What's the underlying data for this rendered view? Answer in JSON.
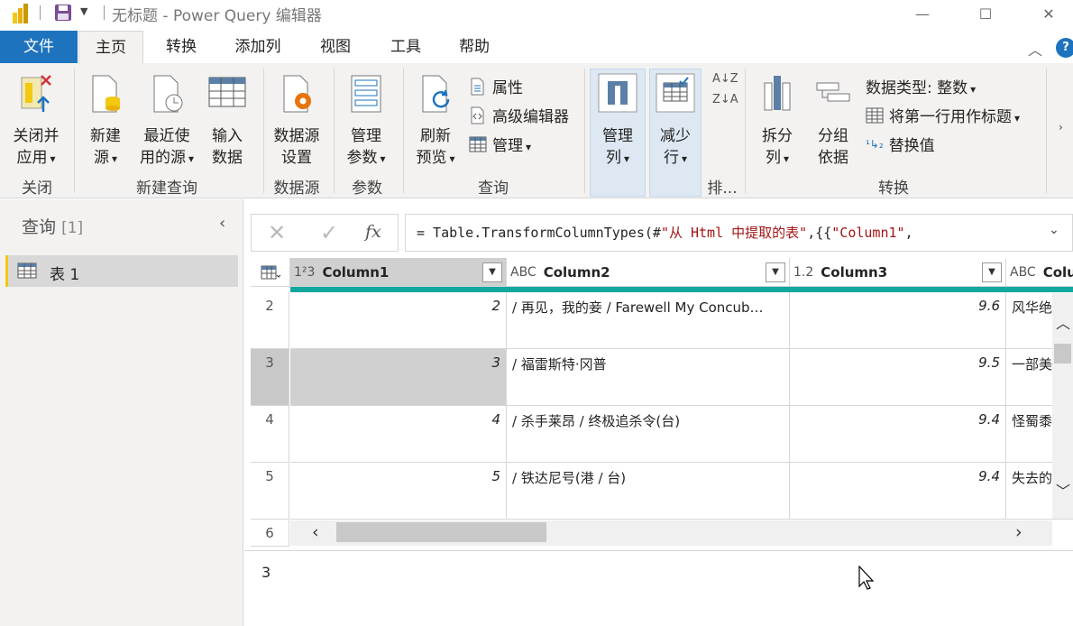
{
  "window": {
    "title": "无标题 - Power Query 编辑器",
    "minimize": "—",
    "maximize": "☐",
    "close": "✕"
  },
  "tabs": [
    {
      "label": "文件"
    },
    {
      "label": "主页"
    },
    {
      "label": "转换"
    },
    {
      "label": "添加列"
    },
    {
      "label": "视图"
    },
    {
      "label": "工具"
    },
    {
      "label": "帮助"
    }
  ],
  "help": "?",
  "ribbon": {
    "close_apply": {
      "line1": "关闭并",
      "line2": "应用"
    },
    "new_source": {
      "line1": "新建",
      "line2": "源"
    },
    "recent_sources": {
      "line1": "最近使",
      "line2": "用的源"
    },
    "enter_data": {
      "line1": "输入",
      "line2": "数据"
    },
    "ds_settings": {
      "line1": "数据源",
      "line2": "设置"
    },
    "manage_params": {
      "line1": "管理",
      "line2": "参数"
    },
    "refresh": {
      "line1": "刷新",
      "line2": "预览"
    },
    "properties": "属性",
    "advanced_editor": "高级编辑器",
    "manage": "管理",
    "manage_columns": {
      "line1": "管理",
      "line2": "列"
    },
    "reduce_rows": {
      "line1": "减少",
      "line2": "行"
    },
    "split_column": {
      "line1": "拆分",
      "line2": "列"
    },
    "group_by": {
      "line1": "分组",
      "line2": "依据"
    },
    "data_type": "数据类型: 整数",
    "first_row_header": "将第一行用作标题",
    "replace_values": "替换值",
    "groups": {
      "close": "关闭",
      "new_query": "新建查询",
      "data_source": "数据源",
      "parameters": "参数",
      "query": "查询",
      "sort": "排...",
      "transform": "转换"
    }
  },
  "queries": {
    "title": "查询",
    "count": "[1]",
    "items": [
      {
        "label": "表 1"
      }
    ]
  },
  "formula": {
    "prefix": "= Table.TransformColumnTypes(#",
    "str1": "\"从 Html 中提取的表\"",
    "mid": ",{{",
    "str2": "\"Column1\"",
    "suffix": ","
  },
  "columns": [
    {
      "type": "1²3",
      "name": "Column1"
    },
    {
      "type": "ABC",
      "name": "Column2"
    },
    {
      "type": "1.2",
      "name": "Column3"
    },
    {
      "type": "ABC",
      "name": "Colu"
    }
  ],
  "rows": [
    {
      "num": "2",
      "c1": "2",
      "c2": "/ 再见，我的妾 / Farewell My Concub…",
      "c3": "9.6",
      "c4": "风华绝"
    },
    {
      "num": "3",
      "c1": "3",
      "c2": "/ 福雷斯特·冈普",
      "c3": "9.5",
      "c4": "一部美"
    },
    {
      "num": "4",
      "c1": "4",
      "c2": "/ 杀手莱昂 / 终极追杀令(台)",
      "c3": "9.4",
      "c4": "怪蜀黍"
    },
    {
      "num": "5",
      "c1": "5",
      "c2": "/ 铁达尼号(港 / 台)",
      "c3": "9.4",
      "c4": "失去的"
    },
    {
      "num": "6"
    }
  ],
  "selected_value": "3"
}
